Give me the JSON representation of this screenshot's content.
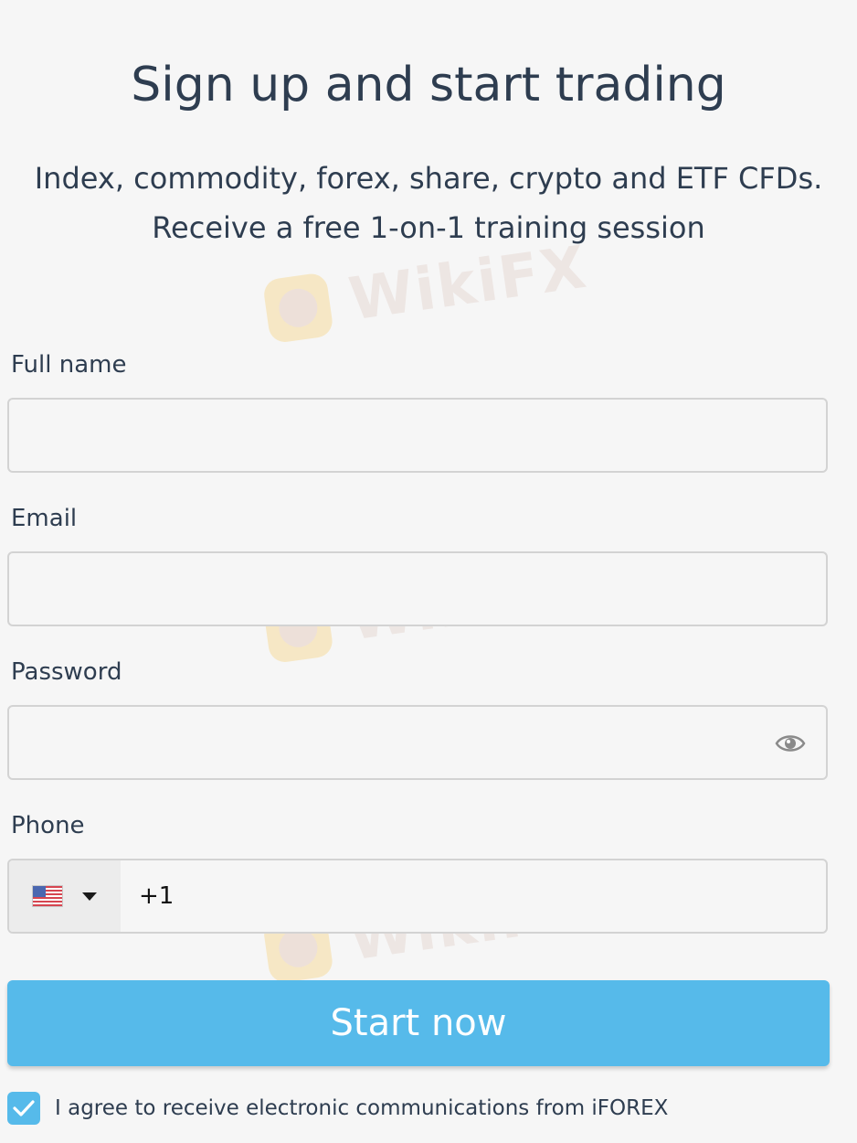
{
  "header": {
    "title": "Sign up and start trading",
    "subtitle_line1": "Index, commodity, forex, share, crypto and ETF CFDs.",
    "subtitle_line2": "Receive a free 1-on-1 training session"
  },
  "form": {
    "full_name": {
      "label": "Full name",
      "value": "",
      "placeholder": ""
    },
    "email": {
      "label": "Email",
      "value": "",
      "placeholder": ""
    },
    "password": {
      "label": "Password",
      "value": "",
      "placeholder": "",
      "toggle_icon": "eye-icon"
    },
    "phone": {
      "label": "Phone",
      "country_flag": "us-flag-icon",
      "dial_code": "+1"
    }
  },
  "cta": {
    "label": "Start now"
  },
  "consent": {
    "checked": true,
    "text": "I agree to receive electronic communications from iFOREX"
  },
  "watermark": {
    "text": "WikiFX"
  },
  "colors": {
    "accent": "#56baea",
    "text": "#2e3d50",
    "background": "#f6f6f6",
    "border": "#d3d3d3"
  }
}
